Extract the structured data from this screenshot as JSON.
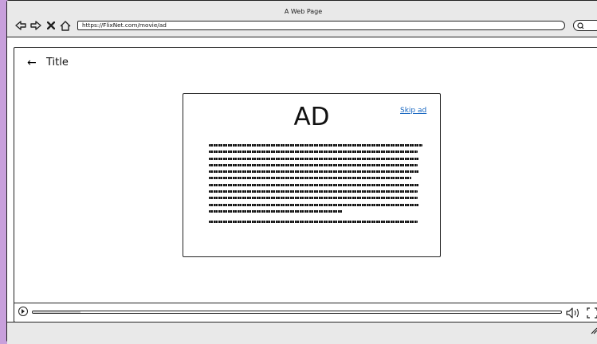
{
  "window": {
    "title": "A Web Page"
  },
  "browser": {
    "url": "https://FlixNet.com/movie/ad"
  },
  "page": {
    "back_glyph": "←",
    "title": "Title"
  },
  "ad": {
    "heading": "AD",
    "skip_label": "Skip ad",
    "skip_color": "#1565c0"
  },
  "player": {
    "progress": 0.09
  }
}
